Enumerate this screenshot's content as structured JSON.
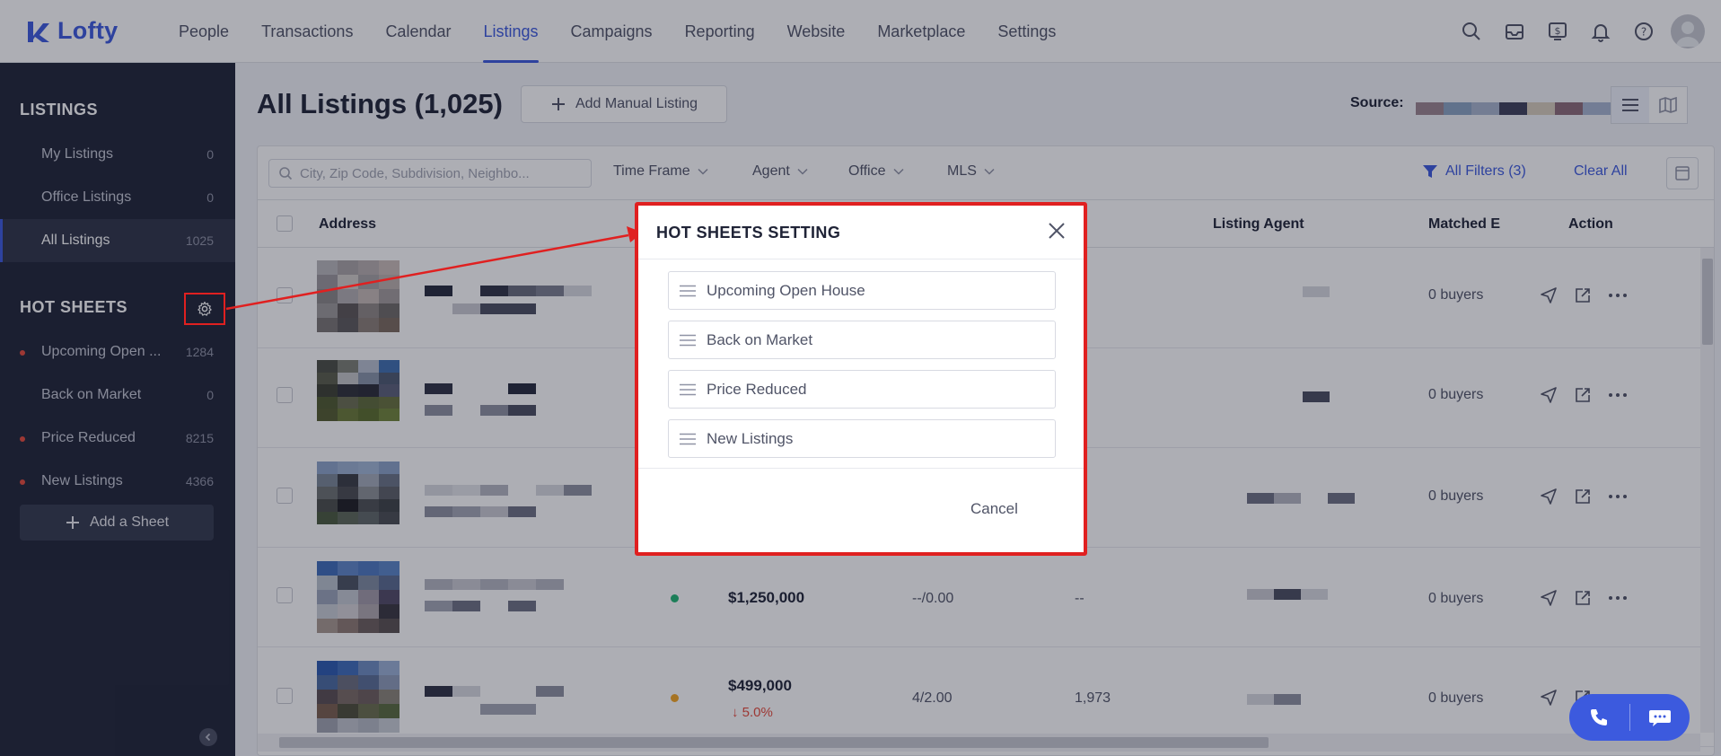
{
  "topnav": {
    "logo_text": "Lofty",
    "items": [
      {
        "label": "People",
        "active": false
      },
      {
        "label": "Transactions",
        "active": false
      },
      {
        "label": "Calendar",
        "active": false
      },
      {
        "label": "Listings",
        "active": true
      },
      {
        "label": "Campaigns",
        "active": false
      },
      {
        "label": "Reporting",
        "active": false
      },
      {
        "label": "Website",
        "active": false
      },
      {
        "label": "Marketplace",
        "active": false
      },
      {
        "label": "Settings",
        "active": false
      }
    ],
    "icons": [
      "search-icon",
      "inbox-icon",
      "dollar-icon",
      "bell-icon",
      "help-icon",
      "avatar"
    ]
  },
  "sidebar": {
    "listings_heading": "LISTINGS",
    "listings": [
      {
        "label": "My Listings",
        "count": "0"
      },
      {
        "label": "Office Listings",
        "count": "0"
      },
      {
        "label": "All Listings",
        "count": "1025"
      }
    ],
    "hotsheets_heading": "HOT SHEETS",
    "hotsheets": [
      {
        "label": "Upcoming Open ...",
        "count": "1284"
      },
      {
        "label": "Back on Market",
        "count": "0"
      },
      {
        "label": "Price Reduced",
        "count": "8215"
      },
      {
        "label": "New Listings",
        "count": "4366"
      }
    ],
    "add_sheet_label": "Add a Sheet"
  },
  "main": {
    "title": "All Listings (1,025)",
    "add_manual_label": "Add Manual Listing",
    "source_label": "Source:",
    "search_placeholder": "City, Zip Code, Subdivision, Neighbo...",
    "filters": [
      "Time Frame",
      "Agent",
      "Office",
      "MLS"
    ],
    "all_filters_label": "All Filters (3)",
    "clear_all_label": "Clear All",
    "columns": {
      "address": "Address",
      "listing_agent": "Listing Agent",
      "matched": "Matched E",
      "action": "Action"
    },
    "rows": [
      {
        "price": "",
        "price_change": "",
        "beds_baths": "",
        "sqft": "",
        "buyers": "0 buyers",
        "status_color": ""
      },
      {
        "price": "",
        "price_change": "",
        "beds_baths": "",
        "sqft": "",
        "buyers": "0 buyers",
        "status_color": ""
      },
      {
        "price": "",
        "price_change": "",
        "beds_baths": "",
        "sqft": "",
        "buyers": "0 buyers",
        "status_color": ""
      },
      {
        "price": "$1,250,000",
        "price_change": "",
        "beds_baths": "--/0.00",
        "sqft": "--",
        "buyers": "0 buyers",
        "status_color": "#21b573"
      },
      {
        "price": "$499,000",
        "price_change": "5.0%",
        "beds_baths": "4/2.00",
        "sqft": "1,973",
        "buyers": "0 buyers",
        "status_color": "#f5a623"
      }
    ]
  },
  "modal": {
    "title": "HOT SHEETS SETTING",
    "sheets": [
      "Upcoming Open House",
      "Back on Market",
      "Price Reduced",
      "New Listings"
    ],
    "cancel_label": "Cancel"
  },
  "colors": {
    "accent": "#3c5ade",
    "sidebar_bg": "#202437",
    "highlight": "#e02020"
  }
}
